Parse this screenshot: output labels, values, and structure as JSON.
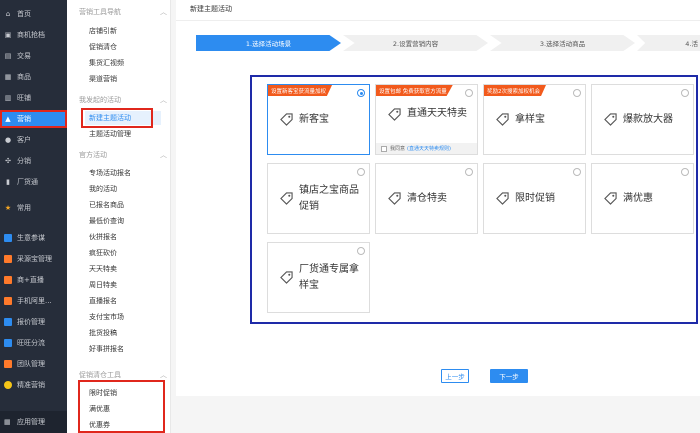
{
  "nav1": {
    "items": [
      {
        "label": "首页",
        "icon": "home-icon"
      },
      {
        "label": "商机抢档",
        "icon": "opportunity-icon"
      },
      {
        "label": "交易",
        "icon": "trade-icon"
      },
      {
        "label": "商品",
        "icon": "product-icon"
      },
      {
        "label": "旺铺",
        "icon": "shop-icon"
      },
      {
        "label": "营销",
        "icon": "marketing-icon"
      },
      {
        "label": "客户",
        "icon": "customer-icon"
      },
      {
        "label": "分销",
        "icon": "distribution-icon"
      },
      {
        "label": "厂货通",
        "icon": "factory-icon"
      },
      {
        "label": "常用",
        "icon": "star-icon"
      },
      {
        "label": "生意参谋",
        "icon": "business-icon"
      },
      {
        "label": "采源宝管理",
        "icon": "source-icon"
      },
      {
        "label": "商+直播",
        "icon": "live-icon"
      },
      {
        "label": "手机阿里...",
        "icon": "mobile-icon"
      },
      {
        "label": "报价管理",
        "icon": "quote-icon"
      },
      {
        "label": "旺旺分流",
        "icon": "wangwang-icon"
      },
      {
        "label": "团队管理",
        "icon": "team-icon"
      },
      {
        "label": "精准营销",
        "icon": "precision-icon"
      }
    ],
    "bottom": "应用管理"
  },
  "nav2": {
    "sections": [
      {
        "title": "营销工具导航",
        "items": [
          "店铺引新",
          "促销清仓",
          "集货汇视频",
          "渠道营销"
        ]
      },
      {
        "title": "我发起的活动",
        "items": [
          "新建主题活动",
          "主题活动管理"
        ]
      },
      {
        "title": "官方活动",
        "items": [
          "专场活动报名",
          "我的活动",
          "已报名商品",
          "最低价查询",
          "伙拼报名",
          "疯狂砍价",
          "天天特卖",
          "周日特卖",
          "直播报名",
          "支付宝市场",
          "批货投稿",
          "好事拼报名"
        ]
      },
      {
        "title": "促销清仓工具",
        "items": [
          "限时促销",
          "满优惠",
          "优惠券"
        ]
      }
    ]
  },
  "main": {
    "title": "新建主题活动",
    "steps": [
      "1.选择活动场景",
      "2.设置营销内容",
      "3.选择活动商品",
      "4.活"
    ],
    "cards": [
      {
        "name": "新客宝",
        "tag": "设置新客宝获流量加权",
        "selected": true
      },
      {
        "name": "直通天天特卖",
        "tag": "设置包邮 免费获取官方流量",
        "footer": "我同意",
        "footer_link": "(直通天天特卖规则)"
      },
      {
        "name": "拿样宝",
        "tag": "奖励2次搜索加权机会"
      },
      {
        "name": "爆款放大器"
      },
      {
        "name": "镇店之宝商品促销"
      },
      {
        "name": "清仓特卖"
      },
      {
        "name": "限时促销"
      },
      {
        "name": "满优惠"
      },
      {
        "name": "厂货通专属拿样宝"
      }
    ],
    "prev_button": "上一步",
    "next_button": "下一步"
  },
  "colors": {
    "accent": "#2d8cf0",
    "tag": "#f25a1c",
    "highlight": "#e0271c",
    "panel_border": "#1e2aa8"
  }
}
